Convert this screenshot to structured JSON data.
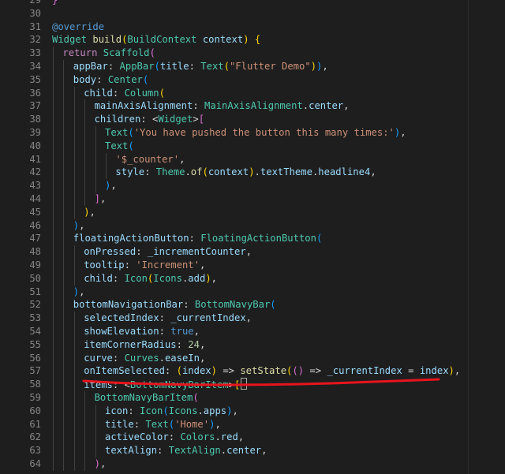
{
  "editor": {
    "theme_colors": {
      "background": "#1e1e1e",
      "line_number": "#858585",
      "keyword": "#c586c0",
      "class": "#4ec9b0",
      "function": "#dcdcaa",
      "parameter": "#9cdcfe",
      "string": "#ce9178",
      "annotation_red": "#e8141d"
    },
    "lines": [
      {
        "n": "29",
        "tokens": [
          [
            "t-br2",
            "}"
          ]
        ],
        "indent": 0
      },
      {
        "n": "30",
        "tokens": [],
        "indent": 0
      },
      {
        "n": "31",
        "tokens": [
          [
            "t-ann",
            "@override"
          ]
        ],
        "indent": 0
      },
      {
        "n": "32",
        "tokens": [
          [
            "t-cls",
            "Widget"
          ],
          [
            "t-plain",
            " "
          ],
          [
            "t-fn",
            "build"
          ],
          [
            "t-br1",
            "("
          ],
          [
            "t-cls",
            "BuildContext"
          ],
          [
            "t-plain",
            " "
          ],
          [
            "t-var",
            "context"
          ],
          [
            "t-br1",
            ")"
          ],
          [
            "t-plain",
            " "
          ],
          [
            "t-br1",
            "{"
          ]
        ],
        "indent": 0
      },
      {
        "n": "33",
        "tokens": [
          [
            "t-kw",
            "return"
          ],
          [
            "t-plain",
            " "
          ],
          [
            "t-cls",
            "Scaffold"
          ],
          [
            "t-br2",
            "("
          ]
        ],
        "indent": 1
      },
      {
        "n": "34",
        "tokens": [
          [
            "t-prm",
            "appBar"
          ],
          [
            "t-plain",
            ": "
          ],
          [
            "t-cls",
            "AppBar"
          ],
          [
            "t-br3",
            "("
          ],
          [
            "t-prm",
            "title"
          ],
          [
            "t-plain",
            ": "
          ],
          [
            "t-cls",
            "Text"
          ],
          [
            "t-br1",
            "("
          ],
          [
            "t-str",
            "\"Flutter Demo\""
          ],
          [
            "t-br1",
            ")"
          ],
          [
            "t-br3",
            ")"
          ],
          [
            "t-plain",
            ","
          ]
        ],
        "indent": 2
      },
      {
        "n": "35",
        "tokens": [
          [
            "t-prm",
            "body"
          ],
          [
            "t-plain",
            ": "
          ],
          [
            "t-cls",
            "Center"
          ],
          [
            "t-br3",
            "("
          ]
        ],
        "indent": 2
      },
      {
        "n": "36",
        "tokens": [
          [
            "t-prm",
            "child"
          ],
          [
            "t-plain",
            ": "
          ],
          [
            "t-cls",
            "Column"
          ],
          [
            "t-br1",
            "("
          ]
        ],
        "indent": 3
      },
      {
        "n": "37",
        "tokens": [
          [
            "t-prm",
            "mainAxisAlignment"
          ],
          [
            "t-plain",
            ": "
          ],
          [
            "t-cls",
            "MainAxisAlignment"
          ],
          [
            "t-plain",
            "."
          ],
          [
            "t-var",
            "center"
          ],
          [
            "t-plain",
            ","
          ]
        ],
        "indent": 4
      },
      {
        "n": "38",
        "tokens": [
          [
            "t-prm",
            "children"
          ],
          [
            "t-plain",
            ": "
          ],
          [
            "t-plain",
            "<"
          ],
          [
            "t-cls",
            "Widget"
          ],
          [
            "t-plain",
            ">"
          ],
          [
            "t-br2",
            "["
          ]
        ],
        "indent": 4
      },
      {
        "n": "39",
        "tokens": [
          [
            "t-cls",
            "Text"
          ],
          [
            "t-br3",
            "("
          ],
          [
            "t-str",
            "'You have pushed the button this many times:'"
          ],
          [
            "t-br3",
            ")"
          ],
          [
            "t-plain",
            ","
          ]
        ],
        "indent": 5
      },
      {
        "n": "40",
        "tokens": [
          [
            "t-cls",
            "Text"
          ],
          [
            "t-br3",
            "("
          ]
        ],
        "indent": 5
      },
      {
        "n": "41",
        "tokens": [
          [
            "t-str",
            "'$_counter'"
          ],
          [
            "t-plain",
            ","
          ]
        ],
        "indent": 6
      },
      {
        "n": "42",
        "tokens": [
          [
            "t-prm",
            "style"
          ],
          [
            "t-plain",
            ": "
          ],
          [
            "t-cls",
            "Theme"
          ],
          [
            "t-plain",
            "."
          ],
          [
            "t-fn",
            "of"
          ],
          [
            "t-br1",
            "("
          ],
          [
            "t-var",
            "context"
          ],
          [
            "t-br1",
            ")"
          ],
          [
            "t-plain",
            "."
          ],
          [
            "t-var",
            "textTheme"
          ],
          [
            "t-plain",
            "."
          ],
          [
            "t-var",
            "headline4"
          ],
          [
            "t-plain",
            ","
          ]
        ],
        "indent": 6
      },
      {
        "n": "43",
        "tokens": [
          [
            "t-br3",
            ")"
          ],
          [
            "t-plain",
            ","
          ]
        ],
        "indent": 5
      },
      {
        "n": "44",
        "tokens": [
          [
            "t-br2",
            "]"
          ],
          [
            "t-plain",
            ","
          ]
        ],
        "indent": 4
      },
      {
        "n": "45",
        "tokens": [
          [
            "t-br1",
            ")"
          ],
          [
            "t-plain",
            ","
          ]
        ],
        "indent": 3
      },
      {
        "n": "46",
        "tokens": [
          [
            "t-br3",
            ")"
          ],
          [
            "t-plain",
            ","
          ]
        ],
        "indent": 2
      },
      {
        "n": "47",
        "tokens": [
          [
            "t-prm",
            "floatingActionButton"
          ],
          [
            "t-plain",
            ": "
          ],
          [
            "t-cls",
            "FloatingActionButton"
          ],
          [
            "t-br3",
            "("
          ]
        ],
        "indent": 2
      },
      {
        "n": "48",
        "tokens": [
          [
            "t-prm",
            "onPressed"
          ],
          [
            "t-plain",
            ": "
          ],
          [
            "t-var",
            "_incrementCounter"
          ],
          [
            "t-plain",
            ","
          ]
        ],
        "indent": 3
      },
      {
        "n": "49",
        "tokens": [
          [
            "t-prm",
            "tooltip"
          ],
          [
            "t-plain",
            ": "
          ],
          [
            "t-str",
            "'Increment'"
          ],
          [
            "t-plain",
            ","
          ]
        ],
        "indent": 3
      },
      {
        "n": "50",
        "tokens": [
          [
            "t-prm",
            "child"
          ],
          [
            "t-plain",
            ": "
          ],
          [
            "t-cls",
            "Icon"
          ],
          [
            "t-br1",
            "("
          ],
          [
            "t-cls",
            "Icons"
          ],
          [
            "t-plain",
            "."
          ],
          [
            "t-var",
            "add"
          ],
          [
            "t-br1",
            ")"
          ],
          [
            "t-plain",
            ","
          ]
        ],
        "indent": 3
      },
      {
        "n": "51",
        "tokens": [
          [
            "t-br3",
            ")"
          ],
          [
            "t-plain",
            ","
          ]
        ],
        "indent": 2
      },
      {
        "n": "52",
        "tokens": [
          [
            "t-prm",
            "bottomNavigationBar"
          ],
          [
            "t-plain",
            ": "
          ],
          [
            "t-cls",
            "BottomNavyBar"
          ],
          [
            "t-br3",
            "("
          ]
        ],
        "indent": 2
      },
      {
        "n": "53",
        "tokens": [
          [
            "t-prm",
            "selectedIndex"
          ],
          [
            "t-plain",
            ": "
          ],
          [
            "t-var",
            "_currentIndex"
          ],
          [
            "t-plain",
            ","
          ]
        ],
        "indent": 3
      },
      {
        "n": "54",
        "tokens": [
          [
            "t-prm",
            "showElevation"
          ],
          [
            "t-plain",
            ": "
          ],
          [
            "t-bool",
            "true"
          ],
          [
            "t-plain",
            ","
          ]
        ],
        "indent": 3
      },
      {
        "n": "55",
        "tokens": [
          [
            "t-prm",
            "itemCornerRadius"
          ],
          [
            "t-plain",
            ": "
          ],
          [
            "t-num",
            "24"
          ],
          [
            "t-plain",
            ","
          ]
        ],
        "indent": 3
      },
      {
        "n": "56",
        "tokens": [
          [
            "t-prm",
            "curve"
          ],
          [
            "t-plain",
            ": "
          ],
          [
            "t-cls",
            "Curves"
          ],
          [
            "t-plain",
            "."
          ],
          [
            "t-var",
            "easeIn"
          ],
          [
            "t-plain",
            ","
          ]
        ],
        "indent": 3
      },
      {
        "n": "57",
        "tokens": [
          [
            "t-prm",
            "onItemSelected"
          ],
          [
            "t-plain",
            ": "
          ],
          [
            "t-br1",
            "("
          ],
          [
            "t-var",
            "index"
          ],
          [
            "t-br1",
            ")"
          ],
          [
            "t-plain",
            " => "
          ],
          [
            "t-fn",
            "setState"
          ],
          [
            "t-br1",
            "("
          ],
          [
            "t-br2",
            "()"
          ],
          [
            "t-plain",
            " => "
          ],
          [
            "t-var",
            "_currentIndex"
          ],
          [
            "t-plain",
            " = "
          ],
          [
            "t-var",
            "index"
          ],
          [
            "t-br1",
            ")"
          ],
          [
            "t-plain",
            ","
          ]
        ],
        "indent": 3
      },
      {
        "n": "58",
        "tokens": [
          [
            "t-prm",
            "items"
          ],
          [
            "t-plain",
            ": "
          ],
          [
            "t-plain",
            "<"
          ],
          [
            "t-cls",
            "BottomNavyBarItem"
          ],
          [
            "t-plain",
            ">"
          ],
          [
            "t-br1",
            "["
          ]
        ],
        "indent": 3,
        "cursor": true
      },
      {
        "n": "59",
        "tokens": [
          [
            "t-cls",
            "BottomNavyBarItem"
          ],
          [
            "t-br2",
            "("
          ]
        ],
        "indent": 4
      },
      {
        "n": "60",
        "tokens": [
          [
            "t-prm",
            "icon"
          ],
          [
            "t-plain",
            ": "
          ],
          [
            "t-cls",
            "Icon"
          ],
          [
            "t-br3",
            "("
          ],
          [
            "t-cls",
            "Icons"
          ],
          [
            "t-plain",
            "."
          ],
          [
            "t-var",
            "apps"
          ],
          [
            "t-br3",
            ")"
          ],
          [
            "t-plain",
            ","
          ]
        ],
        "indent": 5
      },
      {
        "n": "61",
        "tokens": [
          [
            "t-prm",
            "title"
          ],
          [
            "t-plain",
            ": "
          ],
          [
            "t-cls",
            "Text"
          ],
          [
            "t-br3",
            "("
          ],
          [
            "t-str",
            "'Home'"
          ],
          [
            "t-br3",
            ")"
          ],
          [
            "t-plain",
            ","
          ]
        ],
        "indent": 5
      },
      {
        "n": "62",
        "tokens": [
          [
            "t-prm",
            "activeColor"
          ],
          [
            "t-plain",
            ": "
          ],
          [
            "t-cls",
            "Colors"
          ],
          [
            "t-plain",
            "."
          ],
          [
            "t-var",
            "red"
          ],
          [
            "t-plain",
            ","
          ]
        ],
        "indent": 5
      },
      {
        "n": "63",
        "tokens": [
          [
            "t-prm",
            "textAlign"
          ],
          [
            "t-plain",
            ": "
          ],
          [
            "t-cls",
            "TextAlign"
          ],
          [
            "t-plain",
            "."
          ],
          [
            "t-var",
            "center"
          ],
          [
            "t-plain",
            ","
          ]
        ],
        "indent": 5
      },
      {
        "n": "64",
        "tokens": [
          [
            "t-br2",
            ")"
          ],
          [
            "t-plain",
            ","
          ]
        ],
        "indent": 4
      }
    ]
  }
}
